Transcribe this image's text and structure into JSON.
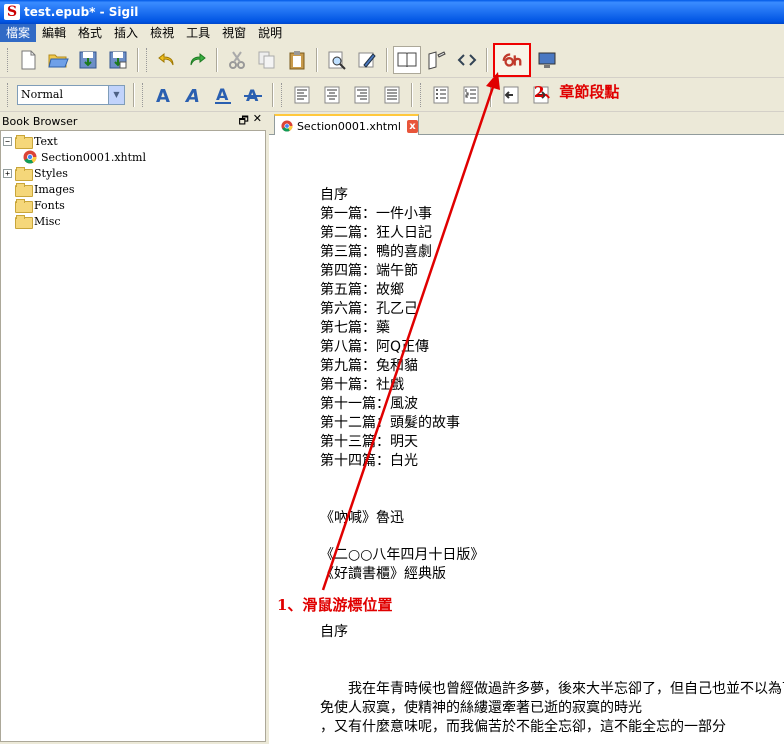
{
  "window": {
    "title": "test.epub* - Sigil",
    "app_icon_glyph": "S"
  },
  "menu": [
    "檔案",
    "編輯",
    "格式",
    "插入",
    "檢視",
    "工具",
    "視窗",
    "說明"
  ],
  "style_select": {
    "value": "Normal"
  },
  "book_browser": {
    "title": "Book Browser",
    "float_glyph": "🗗",
    "close_glyph": "✕",
    "items": [
      {
        "label": "Text",
        "type": "folder",
        "expanded": true
      },
      {
        "label": "Section0001.xhtml",
        "type": "file"
      },
      {
        "label": "Styles",
        "type": "folder",
        "expanded": false
      },
      {
        "label": "Images",
        "type": "folder"
      },
      {
        "label": "Fonts",
        "type": "folder"
      },
      {
        "label": "Misc",
        "type": "folder"
      }
    ]
  },
  "tab": {
    "label": "Section0001.xhtml",
    "close_glyph": "x"
  },
  "content": {
    "toc": [
      "自序",
      "第一篇：一件小事",
      "第二篇：狂人日記",
      "第三篇：鴨的喜劇",
      "第四篇：端午節",
      "第五篇：故鄉",
      "第六篇：孔乙己",
      "第七篇：藥",
      "第八篇：阿Q正傳",
      "第九篇：兔和貓",
      "第十篇：社戲",
      "第十一篇：風波",
      "第十二篇：頭髮的故事",
      "第十三篇：明天",
      "第十四篇：白光"
    ],
    "book_title": "《吶喊》魯迅",
    "edition_1": "《二○○八年四月十日版》",
    "edition_2": "《好讀書櫃》經典版",
    "preface_heading": "自序",
    "body_1": "　　我在年青時候也曾經做過許多夢，後來大半忘卻了，但自己也並不以為可惜。所謂回憶者，雖說可以使人歡欣，有時也不",
    "body_2": "免使人寂寞，使精神的絲縷還牽著已逝的寂寞的時光",
    "body_3": "，又有什麼意味呢，而我偏苦於不能全忘卻，這不能全忘的一部分"
  },
  "annotations": {
    "a1": "1、滑鼠游標位置",
    "a2": "2、章節段點",
    "color": "#e00000"
  }
}
